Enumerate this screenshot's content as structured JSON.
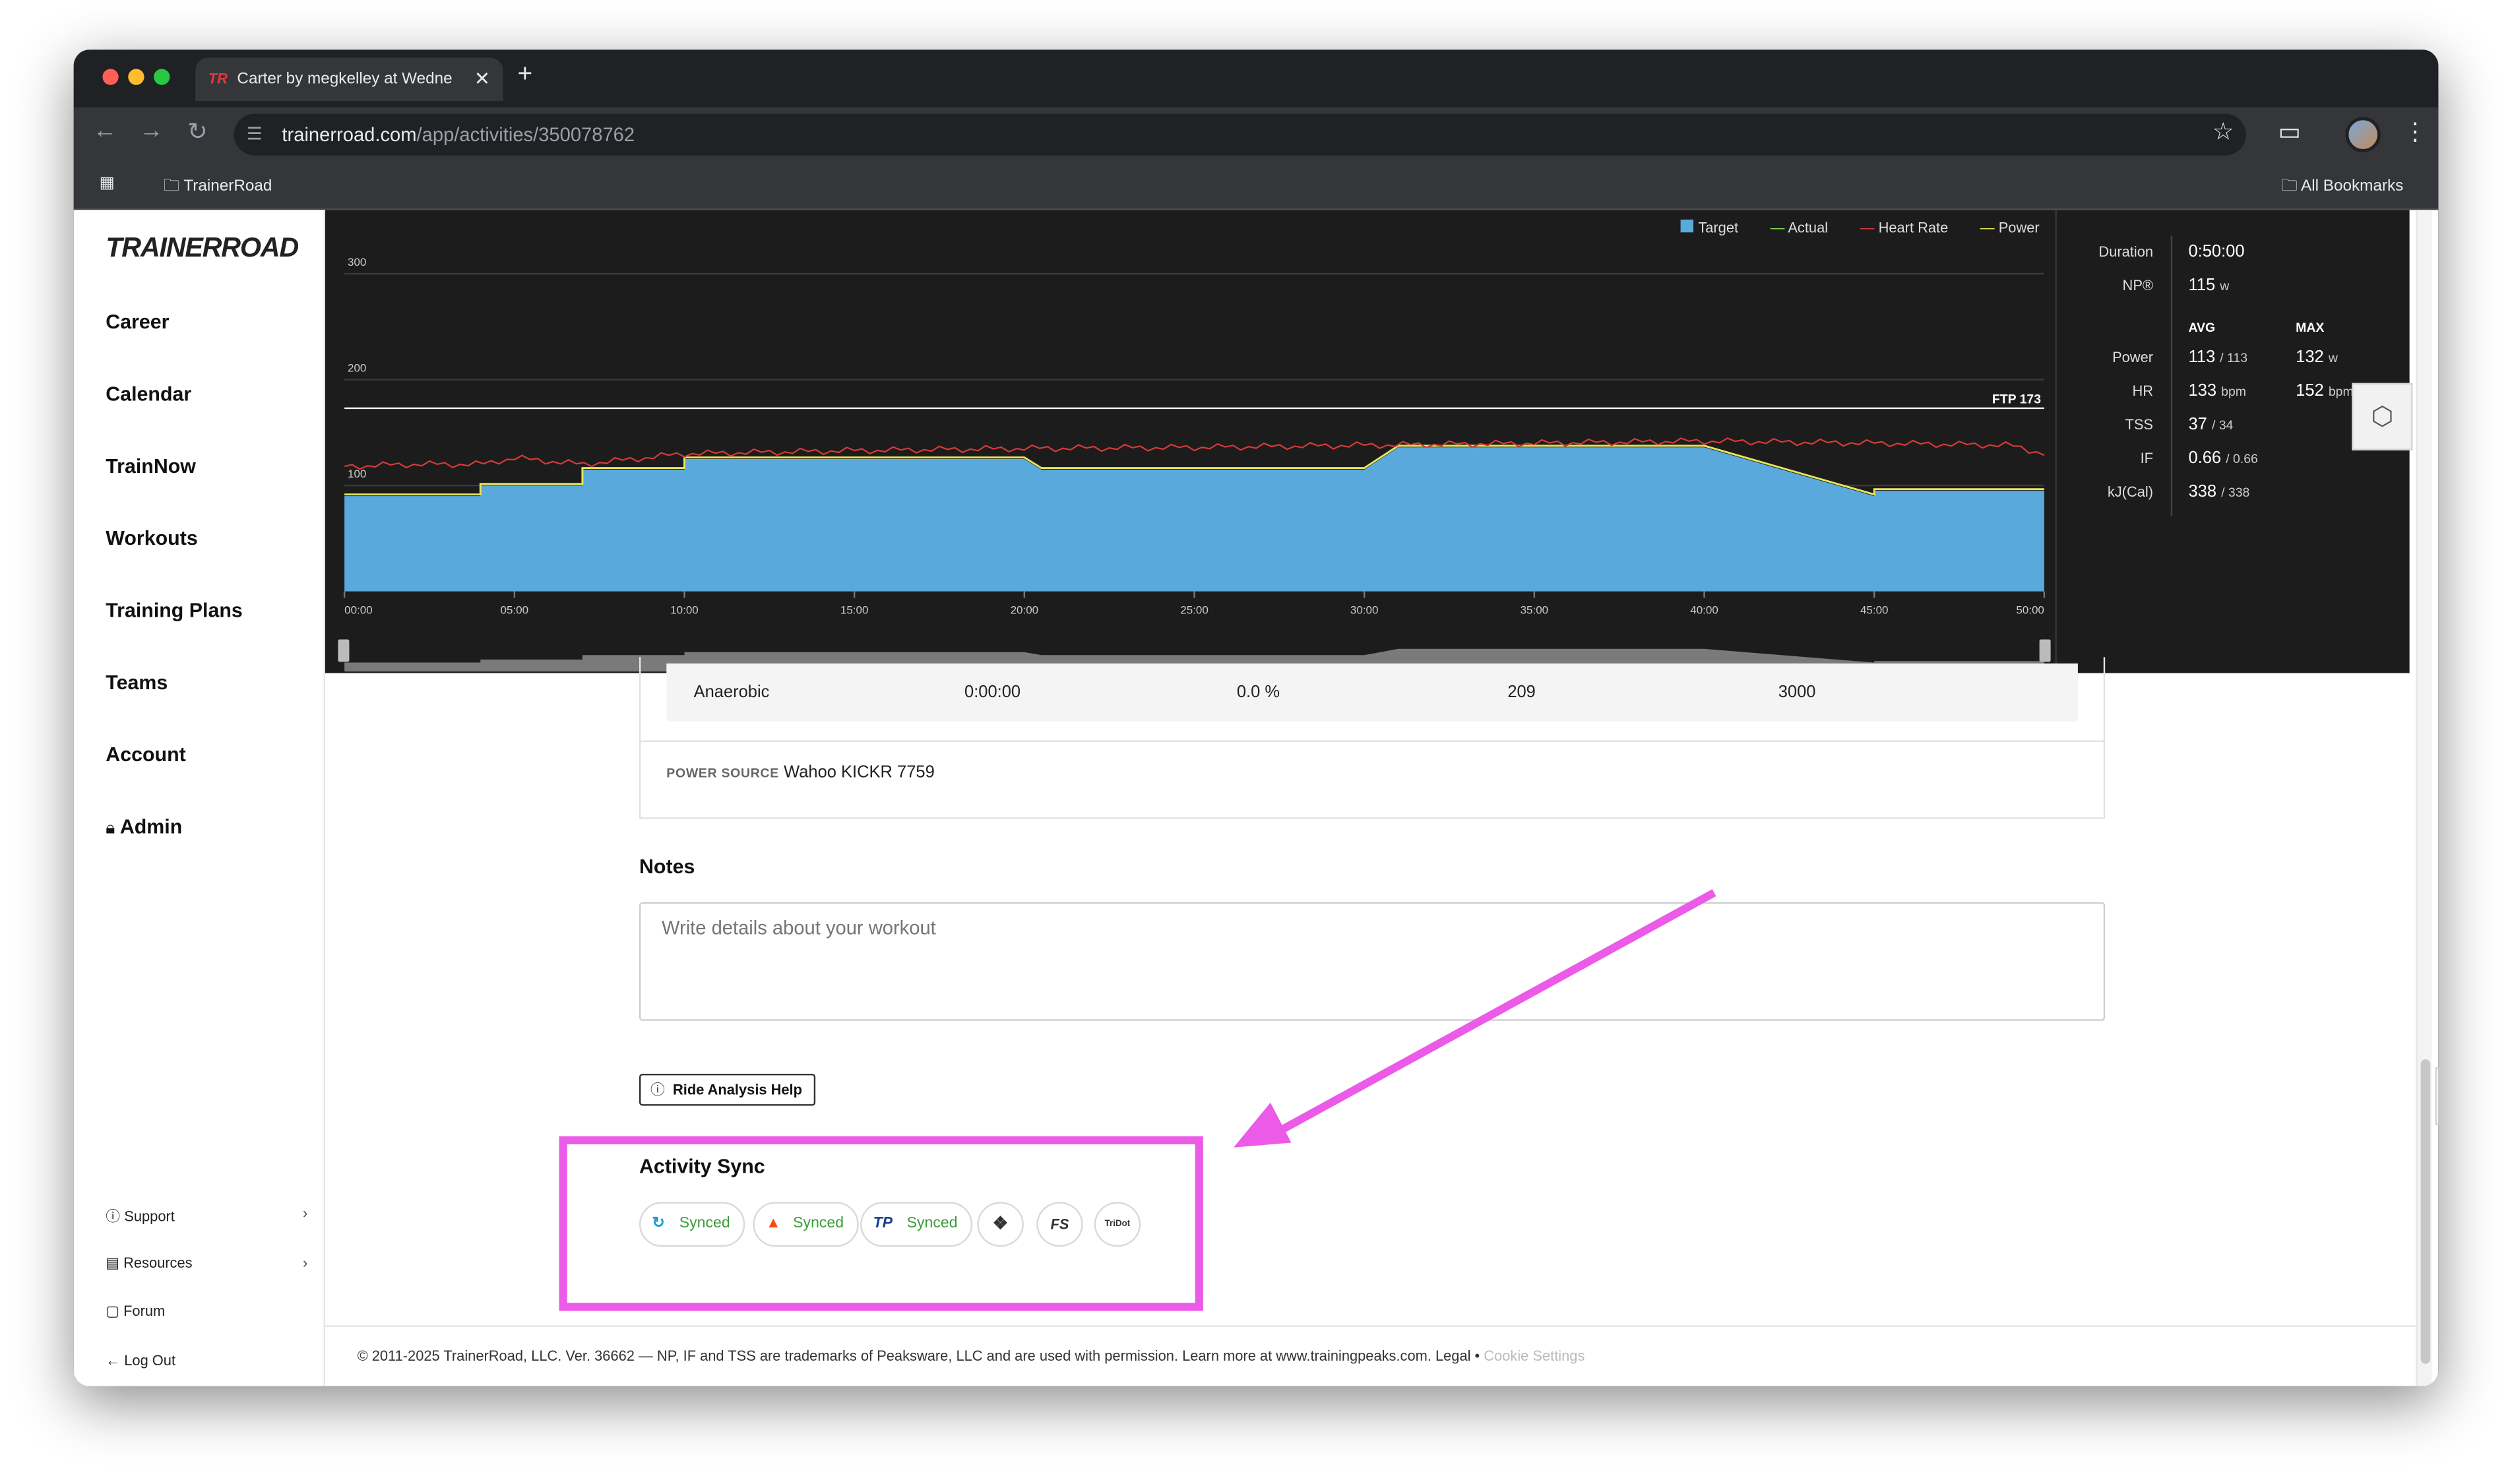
{
  "browser": {
    "tab_title": "Carter by megkelley at Wedne",
    "tab_icon_text": "TR",
    "url_host": "trainerroad.com",
    "url_path": "/app/activities/350078762",
    "bookmark_folder": "TrainerRoad",
    "all_bookmarks": "All Bookmarks"
  },
  "sidebar": {
    "logo": "TRAINERROAD",
    "items": [
      {
        "label": "Career"
      },
      {
        "label": "Calendar"
      },
      {
        "label": "TrainNow"
      },
      {
        "label": "Workouts"
      },
      {
        "label": "Training Plans"
      },
      {
        "label": "Teams"
      },
      {
        "label": "Account"
      },
      {
        "label": "Admin"
      }
    ],
    "footer": [
      {
        "label": "Support"
      },
      {
        "label": "Resources"
      },
      {
        "label": "Forum"
      },
      {
        "label": "Log Out"
      }
    ]
  },
  "chart_data": {
    "type": "area",
    "legend": [
      "Target",
      "Actual",
      "Heart Rate",
      "Power"
    ],
    "ftp_label": "FTP 173",
    "ftp": 173,
    "x_ticks": [
      "00:00",
      "05:00",
      "10:00",
      "15:00",
      "20:00",
      "25:00",
      "30:00",
      "35:00",
      "40:00",
      "45:00",
      "50:00"
    ],
    "y_ticks": [
      "300",
      "200",
      "100"
    ],
    "ylim": [
      0,
      330
    ],
    "xlim": [
      0,
      50
    ],
    "series": [
      {
        "name": "Target",
        "color": "#5aa9dc",
        "x": [
          0,
          4,
          4,
          7,
          7,
          10,
          10,
          20,
          20.5,
          30,
          31,
          40,
          45,
          45,
          50
        ],
        "y": [
          90,
          90,
          100,
          100,
          115,
          115,
          125,
          125,
          115,
          115,
          136,
          136,
          90,
          95,
          95
        ]
      },
      {
        "name": "Heart Rate",
        "color": "#d83a3a",
        "x": [
          0,
          2,
          4,
          5,
          7,
          10,
          15,
          20,
          25,
          30,
          35,
          40,
          45,
          49,
          50
        ],
        "y": [
          118,
          120,
          120,
          126,
          120,
          130,
          133,
          135,
          136,
          138,
          140,
          142,
          140,
          138,
          130
        ]
      }
    ]
  },
  "stats": {
    "duration_label": "Duration",
    "duration_value": "0:50:00",
    "np_label": "NP®",
    "np_value": "115",
    "np_unit": "w",
    "avg_head": "AVG",
    "max_head": "MAX",
    "rows": [
      {
        "label": "Power",
        "avg": "113",
        "avg_sub": "/ 113",
        "max": "132",
        "max_unit": "w"
      },
      {
        "label": "HR",
        "avg": "133",
        "avg_sub": "bpm",
        "max": "152",
        "max_unit": "bpm"
      },
      {
        "label": "TSS",
        "avg": "37",
        "avg_sub": "/ 34",
        "max": "",
        "max_unit": ""
      },
      {
        "label": "IF",
        "avg": "0.66",
        "avg_sub": "/ 0.66",
        "max": "",
        "max_unit": ""
      },
      {
        "label": "kJ(Cal)",
        "avg": "338",
        "avg_sub": "/ 338",
        "max": "",
        "max_unit": ""
      }
    ]
  },
  "zones": {
    "row": {
      "name": "Anaerobic",
      "time": "0:00:00",
      "percent": "0.0 %",
      "low": "209",
      "high": "3000"
    },
    "power_source_label": "POWER SOURCE",
    "power_source_value": "Wahoo KICKR 7759"
  },
  "notes": {
    "title": "Notes",
    "placeholder": "Write details about your workout"
  },
  "help_button": "Ride Analysis Help",
  "activity_sync": {
    "title": "Activity Sync",
    "services": [
      {
        "name": "garmin-connect",
        "status": "Synced"
      },
      {
        "name": "strava",
        "status": "Synced"
      },
      {
        "name": "trainingpeaks",
        "icon_text": "TP",
        "status": "Synced"
      },
      {
        "name": "dropbox"
      },
      {
        "name": "final-surge",
        "icon_text": "FS"
      },
      {
        "name": "trisoul",
        "icon_text": "TriDot"
      }
    ]
  },
  "footer": {
    "text": "© 2011-2025 TrainerRoad, LLC. Ver. 36662 — NP, IF and TSS are trademarks of Peaksware, LLC and are used with permission. Learn more at www.trainingpeaks.com. Legal •",
    "cookie": "Cookie Settings"
  },
  "colors": {
    "highlight": "#ec5ae8",
    "synced_green": "#3b9d37",
    "target_blue": "#5aa9dc",
    "heart_red": "#d83a3a",
    "power_yellow": "#e6e65a"
  }
}
